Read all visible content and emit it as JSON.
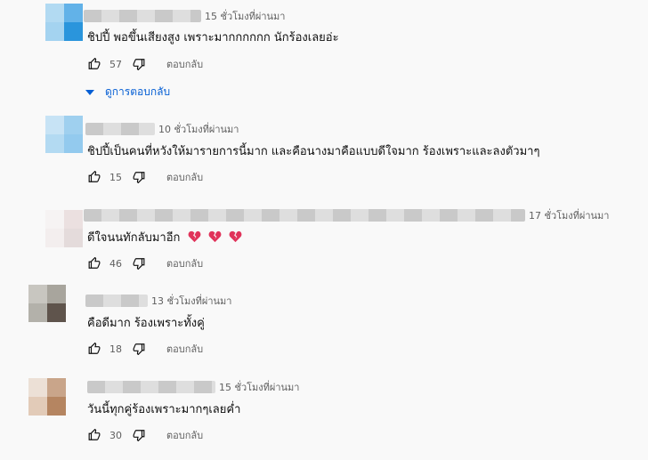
{
  "comments": [
    {
      "timestamp": "15 ชั่วโมงที่ผ่านมา",
      "text": "ชิปปี้ พอขึ้นเสียงสูง เพราะมากกกกกก นักร้องเลยอ่ะ",
      "likes": "57",
      "reply_label": "ตอบกลับ",
      "avatar_colors": [
        "#a9d4ef",
        "#3a9ee0",
        "#b9dcf3",
        "#2c95dd"
      ],
      "emojis": 0
    },
    {
      "timestamp": "10 ชั่วโมงที่ผ่านมา",
      "text": "ชิปปี้เป็นคนที่หวังให้มารายการนี้มาก และคือนางมาคือแบบดีใจมาก ร้องเพราะและลงตัวมาๆ",
      "likes": "15",
      "reply_label": "ตอบกลับ",
      "avatar_colors": [
        "#c6e2f5",
        "#9ccfef",
        "#a8d5f1",
        "#8fc8ec"
      ],
      "emojis": 0
    },
    {
      "timestamp": "17 ชั่วโมงที่ผ่านมา",
      "text": "ดีใจนนทักลับมาอีก",
      "likes": "46",
      "reply_label": "ตอบกลับ",
      "avatar_colors": [
        "#f4f0f0",
        "#e8dcdc",
        "#f2ecec",
        "#e4dada"
      ],
      "emojis": 3
    },
    {
      "timestamp": "13 ชั่วโมงที่ผ่านมา",
      "text": "คือดีมาก ร้องเพราะทั้งคู่",
      "likes": "18",
      "reply_label": "ตอบกลับ",
      "avatar_colors": [
        "#b8b6ad",
        "#8f8a82",
        "#a5a29b",
        "#5f544c"
      ],
      "emojis": 0
    },
    {
      "timestamp": "15 ชั่วโมงที่ผ่านมา",
      "text": "วันนี้ทุกคู่ร้องเพราะมากๆเลยค่ำ",
      "likes": "30",
      "reply_label": "ตอบกลับ",
      "avatar_colors": [
        "#e6d3c4",
        "#c9a58a",
        "#dcc2ad",
        "#b58561"
      ],
      "emojis": 0
    }
  ],
  "view_replies_label": "ดูการตอบกลับ",
  "colors": {
    "link": "#065fd4",
    "secondary_text": "#606060",
    "emoji": "#e0335a"
  },
  "icons": [
    "like-icon",
    "dislike-icon",
    "chevron-down-icon",
    "broken-heart-emoji"
  ]
}
